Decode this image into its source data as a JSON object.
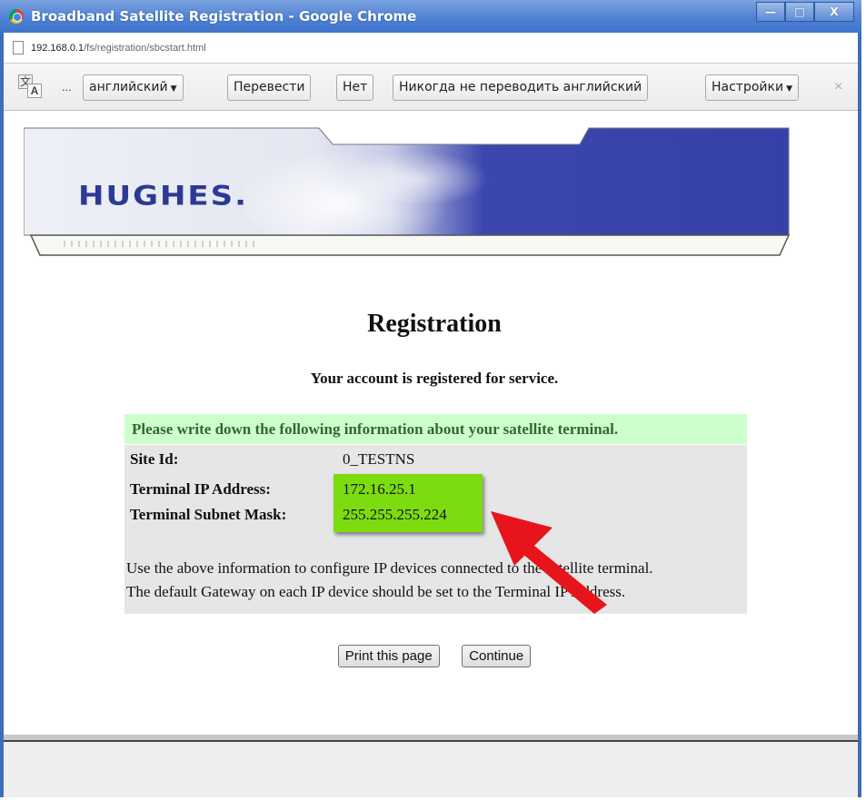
{
  "window": {
    "title": "Broadband Satellite Registration - Google Chrome",
    "controls": {
      "minimize": "—",
      "maximize": "□",
      "close": "X"
    }
  },
  "address": {
    "host": "192.168.0.1",
    "path": "/fs/registration/sbcstart.html"
  },
  "translate_bar": {
    "icon_glyph_1": "文",
    "icon_glyph_2": "A",
    "ellipsis": "...",
    "language_dropdown": "английский",
    "translate_button": "Перевести",
    "no_button": "Нет",
    "never_button": "Никогда не переводить английский",
    "settings_button": "Настройки",
    "close": "×"
  },
  "banner": {
    "logo_text": "HUGHES."
  },
  "page": {
    "title": "Registration",
    "subtitle": "Your account is registered for service.",
    "info_header": "Please write down the following information about your satellite terminal.",
    "fields": [
      {
        "label": "Site Id:",
        "value": "0_TESTNS"
      },
      {
        "label": "Terminal IP Address:",
        "value": "172.16.25.1"
      },
      {
        "label": "Terminal Subnet Mask:",
        "value": "255.255.255.224"
      }
    ],
    "note_line_1": "Use the above information to configure IP devices connected to the satellite terminal.",
    "note_line_2": "The default Gateway on each IP device should be set to the Terminal IP Address.",
    "print_button": "Print this page",
    "continue_button": "Continue"
  },
  "colors": {
    "titlebar": "#4c7fd3",
    "info_header_bg": "#ccffcc",
    "info_header_text": "#336633",
    "info_body_bg": "#e6e6e6",
    "highlight": "#7ddc10",
    "arrow": "#e8141c",
    "banner_blue": "#3541a8"
  }
}
